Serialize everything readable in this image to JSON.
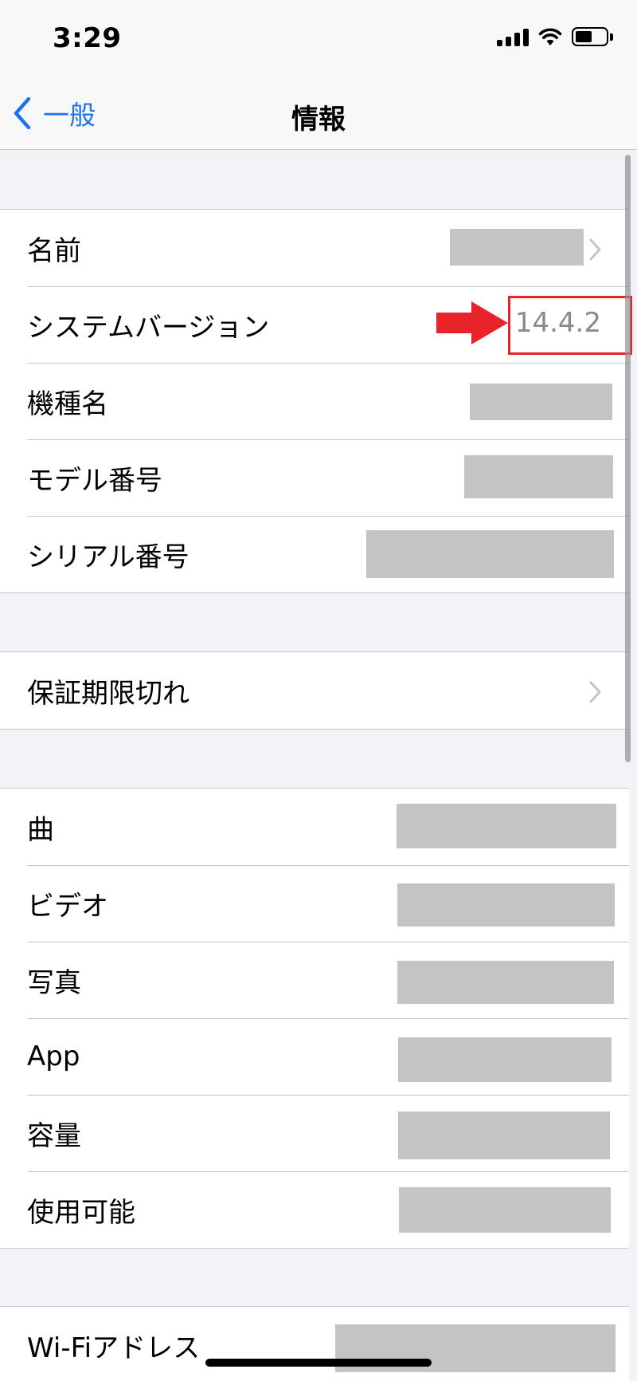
{
  "status_bar": {
    "time": "3:29"
  },
  "nav": {
    "back_label": "一般",
    "title": "情報"
  },
  "groups": [
    {
      "rows": [
        {
          "label": "名前"
        },
        {
          "label": "システムバージョン",
          "value": "14.4.2"
        },
        {
          "label": "機種名"
        },
        {
          "label": "モデル番号"
        },
        {
          "label": "シリアル番号"
        }
      ]
    },
    {
      "rows": [
        {
          "label": "保証期限切れ"
        }
      ]
    },
    {
      "rows": [
        {
          "label": "曲"
        },
        {
          "label": "ビデオ"
        },
        {
          "label": "写真"
        },
        {
          "label": "App"
        },
        {
          "label": "容量"
        },
        {
          "label": "使用可能"
        }
      ]
    },
    {
      "rows": [
        {
          "label": "Wi-Fiアドレス"
        }
      ]
    }
  ],
  "colors": {
    "accent": "#1f73e6",
    "highlight": "#e8232a",
    "redaction": "#c4c4c4"
  },
  "icons": [
    "cellular-signal-icon",
    "wifi-icon",
    "battery-icon",
    "chevron-left-icon",
    "chevron-right-icon",
    "red-arrow-icon"
  ]
}
